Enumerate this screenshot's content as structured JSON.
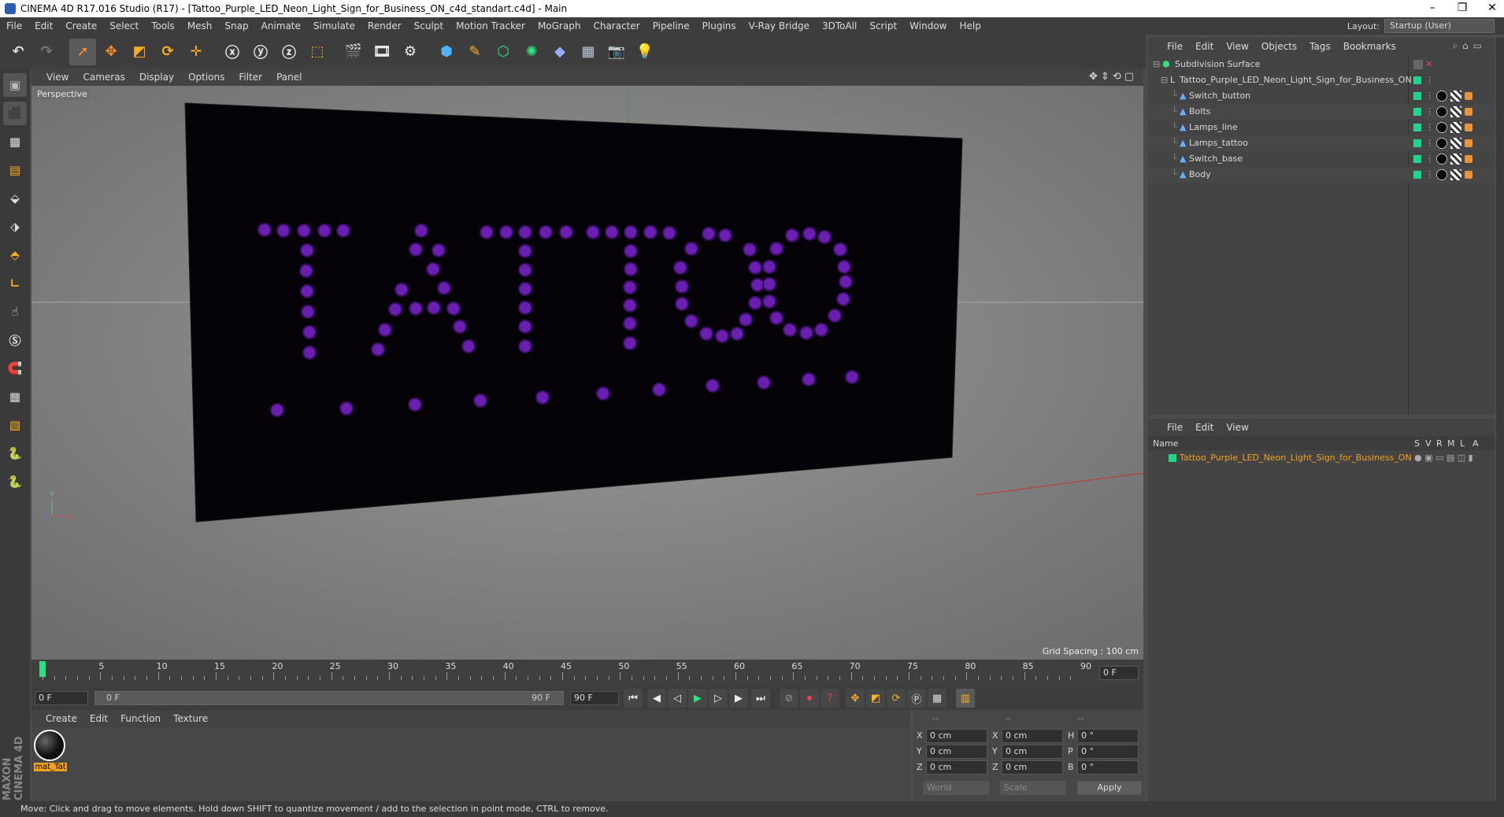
{
  "window": {
    "title": "CINEMA 4D R17.016 Studio (R17) - [Tattoo_Purple_LED_Neon_Light_Sign_for_Business_ON_c4d_standart.c4d] - Main",
    "controls": [
      "–",
      "❐",
      "✕"
    ]
  },
  "menu": [
    "File",
    "Edit",
    "Create",
    "Select",
    "Tools",
    "Mesh",
    "Snap",
    "Animate",
    "Simulate",
    "Render",
    "Sculpt",
    "Motion Tracker",
    "MoGraph",
    "Character",
    "Pipeline",
    "Plugins",
    "V-Ray Bridge",
    "3DToAll",
    "Script",
    "Window",
    "Help"
  ],
  "layout": {
    "label": "Layout:",
    "value": "Startup (User)"
  },
  "viewport": {
    "menu": [
      "View",
      "Cameras",
      "Display",
      "Options",
      "Filter",
      "Panel"
    ],
    "label": "Perspective",
    "grid_spacing": "Grid Spacing : 100 cm",
    "sign_text": "TATTOO",
    "led_color": "#6a1fb0",
    "axis": {
      "y": "Y",
      "x": "X",
      "z": "Z"
    }
  },
  "timeline": {
    "ticks": [
      "0",
      "5",
      "10",
      "15",
      "20",
      "25",
      "30",
      "35",
      "40",
      "45",
      "50",
      "55",
      "60",
      "65",
      "70",
      "75",
      "80",
      "85",
      "90"
    ],
    "current_frame_right": "0 F",
    "start_field": "0 F",
    "range_start": "0 F",
    "range_end": "90 F",
    "end_field": "90 F"
  },
  "material": {
    "menu": [
      "Create",
      "Edit",
      "Function",
      "Texture"
    ],
    "items": [
      {
        "name": "mat_Tat"
      }
    ]
  },
  "coords": {
    "headers": [
      "--",
      "--",
      "--"
    ],
    "rows": [
      {
        "a": "X",
        "av": "0 cm",
        "b": "X",
        "bv": "0 cm",
        "c": "H",
        "cv": "0 °"
      },
      {
        "a": "Y",
        "av": "0 cm",
        "b": "Y",
        "bv": "0 cm",
        "c": "P",
        "cv": "0 °"
      },
      {
        "a": "Z",
        "av": "0 cm",
        "b": "Z",
        "bv": "0 cm",
        "c": "B",
        "cv": "0 °"
      }
    ],
    "world": "World",
    "scale": "Scale",
    "apply": "Apply"
  },
  "object_manager": {
    "menu": [
      "File",
      "Edit",
      "View",
      "Objects",
      "Tags",
      "Bookmarks"
    ],
    "objects": [
      {
        "name": "Subdivision Surface",
        "depth": 0,
        "highlight": false
      },
      {
        "name": "Tattoo_Purple_LED_Neon_Light_Sign_for_Business_ON",
        "depth": 1,
        "highlight": false
      },
      {
        "name": "Switch_button",
        "depth": 2,
        "highlight": false
      },
      {
        "name": "Bolts",
        "depth": 2,
        "highlight": false
      },
      {
        "name": "Lamps_line",
        "depth": 2,
        "highlight": false
      },
      {
        "name": "Lamps_tattoo",
        "depth": 2,
        "highlight": false
      },
      {
        "name": "Switch_base",
        "depth": 2,
        "highlight": false
      },
      {
        "name": "Body",
        "depth": 2,
        "highlight": false
      }
    ]
  },
  "attributes": {
    "menu": [
      "File",
      "Edit",
      "View"
    ],
    "columns": {
      "name": "Name",
      "flags": [
        "S",
        "V",
        "R",
        "M",
        "L",
        "A"
      ]
    },
    "rows": [
      {
        "name": "Tattoo_Purple_LED_Neon_Light_Sign_for_Business_ON"
      }
    ]
  },
  "status": "Move: Click and drag to move elements. Hold down SHIFT to quantize movement / add to the selection in point mode, CTRL to remove.",
  "brand": "MAXON CINEMA 4D"
}
